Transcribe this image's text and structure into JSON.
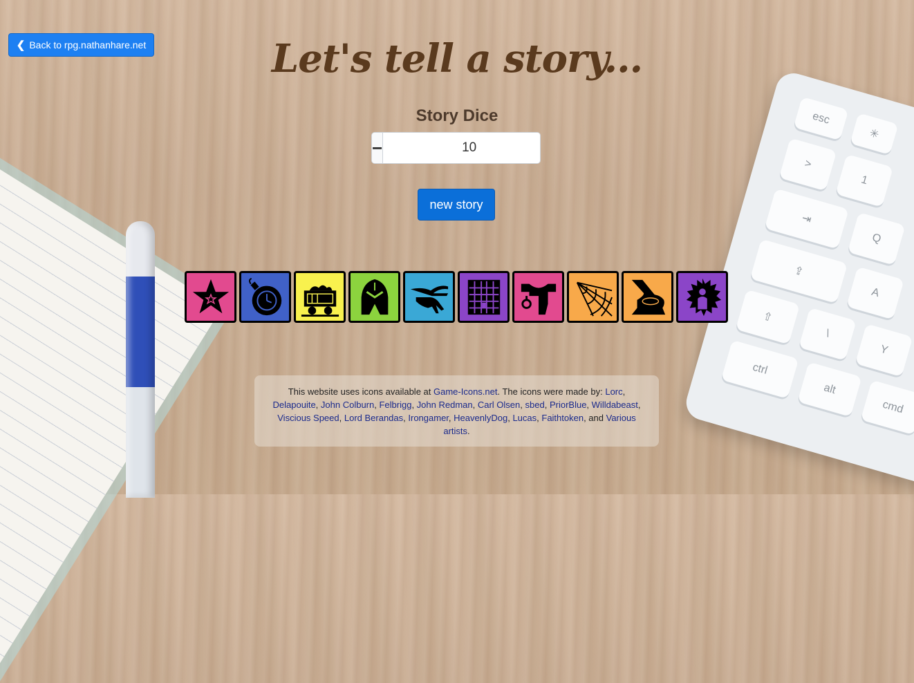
{
  "nav": {
    "back_label": "Back to rpg.nathanhare.net"
  },
  "header": {
    "title": "Let's tell a story..."
  },
  "dice_control": {
    "label": "Story Dice",
    "value": "10",
    "minus": "−",
    "plus": "+"
  },
  "actions": {
    "new_story_label": "new story"
  },
  "dice": [
    {
      "icon": "star-icon",
      "color": "#e24a8f"
    },
    {
      "icon": "bomb-icon",
      "color": "#4061c8"
    },
    {
      "icon": "mine-cart-icon",
      "color": "#f8f14e"
    },
    {
      "icon": "knight-helmet-icon",
      "color": "#8cd33e"
    },
    {
      "icon": "hand-branch-icon",
      "color": "#3aa8d6"
    },
    {
      "icon": "prison-window-icon",
      "color": "#8b45c8"
    },
    {
      "icon": "saddle-icon",
      "color": "#e24a8f"
    },
    {
      "icon": "spider-web-icon",
      "color": "#f8a94a"
    },
    {
      "icon": "tree-stump-icon",
      "color": "#f8a94a"
    },
    {
      "icon": "glowing-person-icon",
      "color": "#8b45c8"
    }
  ],
  "credits": {
    "intro": "This website uses icons available at ",
    "site": "Game-Icons.net",
    "mid": ". The icons were made by: ",
    "authors": [
      "Lorc",
      "Delapouite",
      "John Colburn",
      "Felbrigg",
      "John Redman",
      "Carl Olsen",
      "sbed",
      "PriorBlue",
      "Willdabeast",
      "Viscious Speed",
      "Lord Berandas",
      "Irongamer",
      "HeavenlyDog",
      "Lucas",
      "Faithtoken"
    ],
    "and": ", and ",
    "various": "Various artists",
    "end": "."
  }
}
